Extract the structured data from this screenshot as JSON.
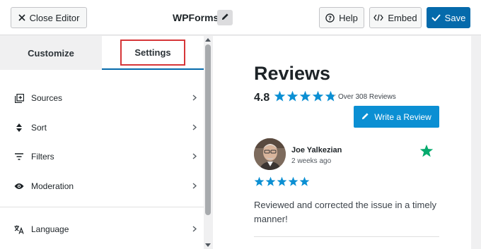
{
  "topbar": {
    "close_label": "Close Editor",
    "title": "WPForms",
    "help_label": "Help",
    "embed_label": "Embed",
    "save_label": "Save"
  },
  "tabs": [
    {
      "label": "Customize",
      "active": false
    },
    {
      "label": "Settings",
      "active": true
    }
  ],
  "menu": [
    {
      "label": "Sources",
      "icon": "sources-icon"
    },
    {
      "label": "Sort",
      "icon": "sort-icon"
    },
    {
      "label": "Filters",
      "icon": "filter-icon"
    },
    {
      "label": "Moderation",
      "icon": "eye-icon"
    },
    {
      "label": "Language",
      "icon": "language-icon"
    }
  ],
  "preview": {
    "heading": "Reviews",
    "rating": "4.8",
    "star_rating": 4.8,
    "review_count": "Over 308 Reviews",
    "write_label": "Write a Review",
    "review": {
      "name": "Joe Yalkezian",
      "time": "2 weeks ago",
      "stars": 5,
      "text": "Reviewed and corrected the issue in a timely manner!"
    }
  },
  "colors": {
    "accent": "#056aab",
    "star": "#0b8fd3",
    "highlight": "#d63638",
    "trust": "#04aa6d"
  }
}
